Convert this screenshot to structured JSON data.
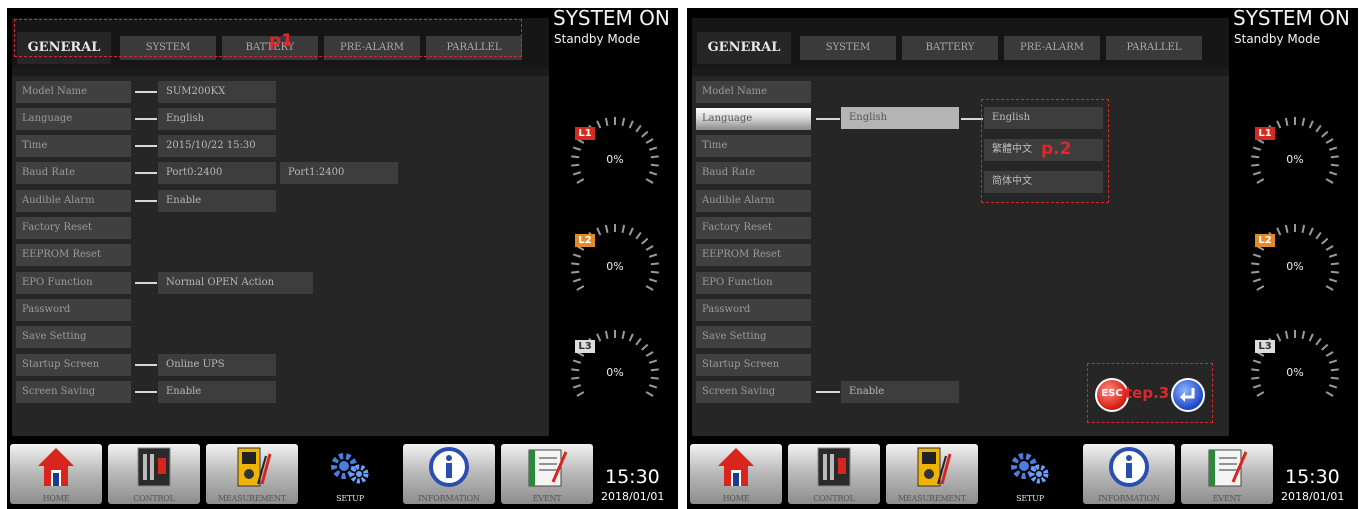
{
  "tabs": [
    "GENERAL",
    "SYSTEM",
    "BATTERY",
    "PRE-ALARM",
    "PARALLEL"
  ],
  "status": {
    "title": "SYSTEM ON",
    "mode": "Standby Mode"
  },
  "phases": [
    {
      "label": "L1",
      "percent": "0%",
      "color": "#d42b20"
    },
    {
      "label": "L2",
      "percent": "0%",
      "color": "#e08a2a"
    },
    {
      "label": "L3",
      "percent": "0%",
      "color": "#dcdcdc"
    }
  ],
  "nav": [
    "HOME",
    "CONTROL",
    "MEASUREMENT",
    "SETUP",
    "INFORMATION",
    "EVENT"
  ],
  "clock": {
    "time": "15:30",
    "date": "2018/01/01"
  },
  "menu": [
    "Model Name",
    "Language",
    "Time",
    "Baud Rate",
    "Audible Alarm",
    "Factory Reset",
    "EEPROM Reset",
    "EPO Function",
    "Password",
    "Save Setting",
    "Startup Screen",
    "Screen Saving"
  ],
  "screen1": {
    "values": {
      "model": "SUM200KX",
      "language": "English",
      "time": "2015/10/22 15:30",
      "port0": "Port0:2400",
      "port1": "Port1:2400",
      "alarm": "Enable",
      "epo": "Normal OPEN Action",
      "startup": "Online UPS",
      "saving": "Enable"
    },
    "annotation": "p1"
  },
  "screen2": {
    "language_value": "English",
    "language_options": [
      "English",
      "繁體中文",
      "简体中文"
    ],
    "saving": "Enable",
    "annotation_step2": "p.2",
    "annotation_step3": "tep.3",
    "esc_label": "ESC"
  }
}
